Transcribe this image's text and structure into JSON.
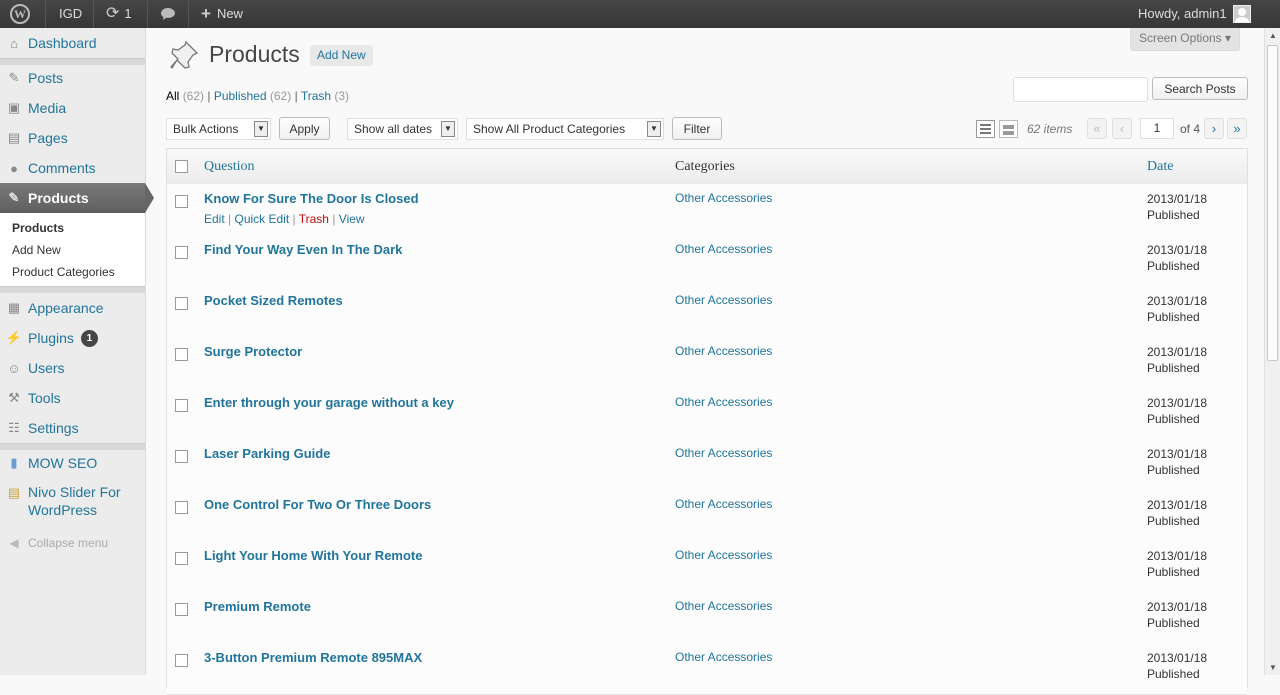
{
  "adminbar": {
    "site": "IGD",
    "updates_count": "1",
    "new_label": "New",
    "howdy": "Howdy, admin1"
  },
  "screen_options": "Screen Options ▾",
  "sidebar": {
    "items": [
      {
        "label": "Dashboard",
        "icon": "dashboard-icon"
      },
      {
        "label": "Posts",
        "icon": "pin-icon"
      },
      {
        "label": "Media",
        "icon": "media-icon"
      },
      {
        "label": "Pages",
        "icon": "pages-icon"
      },
      {
        "label": "Comments",
        "icon": "comments-icon"
      },
      {
        "label": "Products",
        "icon": "pin-icon"
      },
      {
        "label": "Appearance",
        "icon": "appearance-icon"
      },
      {
        "label": "Plugins",
        "icon": "plugins-icon",
        "badge": "1"
      },
      {
        "label": "Users",
        "icon": "users-icon"
      },
      {
        "label": "Tools",
        "icon": "tools-icon"
      },
      {
        "label": "Settings",
        "icon": "settings-icon"
      },
      {
        "label": "MOW SEO",
        "icon": "plugin-icon"
      },
      {
        "label": "Nivo Slider For WordPress",
        "icon": "slider-icon"
      }
    ],
    "submenu": [
      "Products",
      "Add New",
      "Product Categories"
    ],
    "collapse": "Collapse menu"
  },
  "page": {
    "title": "Products",
    "add_new": "Add New",
    "filters": {
      "all": "All",
      "all_count": "(62)",
      "published": "Published",
      "published_count": "(62)",
      "trash": "Trash",
      "trash_count": "(3)"
    },
    "search_button": "Search Posts",
    "bulk_actions": "Bulk Actions",
    "apply": "Apply",
    "dates": "Show all dates",
    "categories_filter": "Show All Product Categories",
    "filter": "Filter",
    "items_count": "62 items",
    "pagination": {
      "first": "«",
      "prev": "‹",
      "current": "1",
      "of": "of 4",
      "next": "›",
      "last": "»"
    }
  },
  "table": {
    "columns": {
      "title": "Question",
      "categories": "Categories",
      "date": "Date"
    },
    "row_actions": {
      "edit": "Edit",
      "quick_edit": "Quick Edit",
      "trash": "Trash",
      "view": "View"
    },
    "rows": [
      {
        "title": "Know For Sure The Door Is Closed",
        "category": "Other Accessories",
        "date": "2013/01/18",
        "status": "Published"
      },
      {
        "title": "Find Your Way Even In The Dark",
        "category": "Other Accessories",
        "date": "2013/01/18",
        "status": "Published"
      },
      {
        "title": "Pocket Sized Remotes",
        "category": "Other Accessories",
        "date": "2013/01/18",
        "status": "Published"
      },
      {
        "title": "Surge Protector",
        "category": "Other Accessories",
        "date": "2013/01/18",
        "status": "Published"
      },
      {
        "title": "Enter through your garage without a key",
        "category": "Other Accessories",
        "date": "2013/01/18",
        "status": "Published"
      },
      {
        "title": "Laser Parking Guide",
        "category": "Other Accessories",
        "date": "2013/01/18",
        "status": "Published"
      },
      {
        "title": "One Control For Two Or Three Doors",
        "category": "Other Accessories",
        "date": "2013/01/18",
        "status": "Published"
      },
      {
        "title": "Light Your Home With Your Remote",
        "category": "Other Accessories",
        "date": "2013/01/18",
        "status": "Published"
      },
      {
        "title": "Premium Remote",
        "category": "Other Accessories",
        "date": "2013/01/18",
        "status": "Published"
      },
      {
        "title": "3-Button Premium Remote 895MAX",
        "category": "Other Accessories",
        "date": "2013/01/18",
        "status": "Published"
      }
    ]
  }
}
